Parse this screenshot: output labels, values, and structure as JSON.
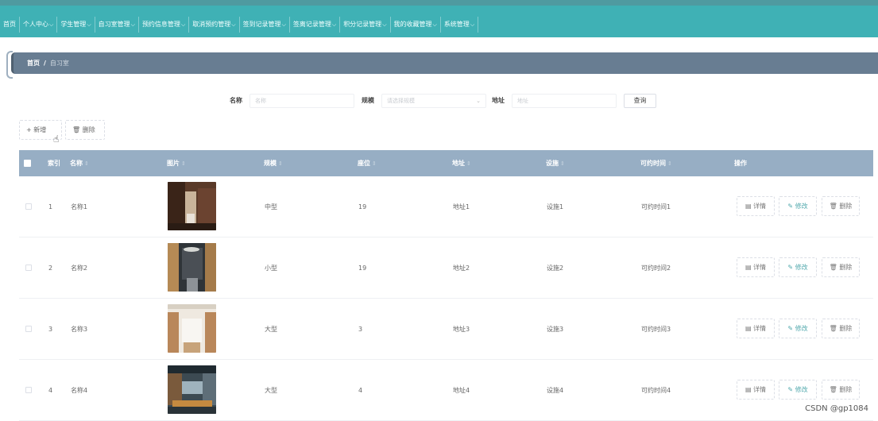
{
  "nav": {
    "items": [
      {
        "label": "首页",
        "caret": false
      },
      {
        "label": "个人中心",
        "caret": true
      },
      {
        "label": "学生管理",
        "caret": true
      },
      {
        "label": "自习室管理",
        "caret": true
      },
      {
        "label": "预约信息管理",
        "caret": true
      },
      {
        "label": "取消预约管理",
        "caret": true
      },
      {
        "label": "签到记录管理",
        "caret": true
      },
      {
        "label": "签离记录管理",
        "caret": true
      },
      {
        "label": "积分记录管理",
        "caret": true
      },
      {
        "label": "我的收藏管理",
        "caret": true
      },
      {
        "label": "系统管理",
        "caret": true
      }
    ]
  },
  "breadcrumb": {
    "home": "首页",
    "separator": "/",
    "current": "自习室"
  },
  "search": {
    "name_label": "名称",
    "name_placeholder": "名称",
    "scale_label": "规模",
    "scale_placeholder": "请选择规模",
    "address_label": "地址",
    "address_placeholder": "地址",
    "query_button": "查询"
  },
  "actions": {
    "add": "+ 新增",
    "delete": "🗑 删除"
  },
  "table": {
    "headers": {
      "index": "索引",
      "name": "名称",
      "image": "图片",
      "scale": "规模",
      "seats": "座位",
      "address": "地址",
      "facilities": "设施",
      "time": "可约时间",
      "ops": "操作"
    },
    "sort_glyph": "⇕",
    "ops": {
      "detail": "详情",
      "edit": "修改",
      "delete": "删除"
    },
    "rows": [
      {
        "index": "1",
        "name": "名称1",
        "scale": "中型",
        "seats": "19",
        "address": "地址1",
        "facilities": "设施1",
        "time": "可约时间1"
      },
      {
        "index": "2",
        "name": "名称2",
        "scale": "小型",
        "seats": "19",
        "address": "地址2",
        "facilities": "设施2",
        "time": "可约时间2"
      },
      {
        "index": "3",
        "name": "名称3",
        "scale": "大型",
        "seats": "3",
        "address": "地址3",
        "facilities": "设施3",
        "time": "可约时间3"
      },
      {
        "index": "4",
        "name": "名称4",
        "scale": "大型",
        "seats": "4",
        "address": "地址4",
        "facilities": "设施4",
        "time": "可约时间4"
      }
    ]
  },
  "watermark": "CSDN @gp1084",
  "colors": {
    "topbar": "#3fb1b5",
    "breadcrumb": "#687d92",
    "table_header": "#97aec4",
    "accent": "#52a9ad"
  }
}
